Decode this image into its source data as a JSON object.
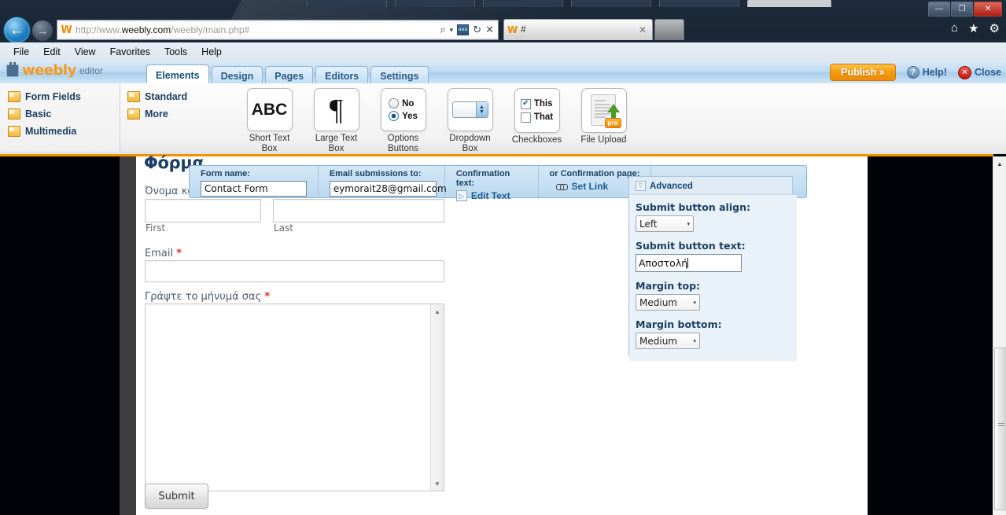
{
  "browser": {
    "url_prefix": "http://www.",
    "url_domain": "weebly.com",
    "url_suffix": "/weebly/main.php#",
    "tab_title": "#",
    "tab_favicon": "W",
    "address_favicon": "W",
    "menus": [
      "File",
      "Edit",
      "View",
      "Favorites",
      "Tools",
      "Help"
    ],
    "icons": {
      "back": "←",
      "forward": "→",
      "search": "⌕",
      "dropdown": "▾",
      "refresh": "↻",
      "stop": "✕",
      "tab_close": "✕",
      "home": "⌂",
      "favorites": "★",
      "tools": "⚙",
      "minimize": "—",
      "restore": "❐",
      "close": "✕"
    }
  },
  "editor": {
    "logo_name": "weebly",
    "logo_sub": "editor",
    "tabs": [
      {
        "label": "Elements",
        "active": true
      },
      {
        "label": "Design",
        "active": false
      },
      {
        "label": "Pages",
        "active": false
      },
      {
        "label": "Editors",
        "active": false
      },
      {
        "label": "Settings",
        "active": false
      }
    ],
    "publish_label": "Publish »",
    "help_label": "Help!",
    "help_icon": "?",
    "close_label": "Close",
    "close_icon": "✕",
    "categories": [
      "Form Fields",
      "Basic",
      "Multimedia"
    ],
    "subcategories": [
      "Standard",
      "More"
    ],
    "tools": [
      {
        "name": "Short Text Box",
        "line1": "Short Text",
        "line2": "Box",
        "glyph": "ABC"
      },
      {
        "name": "Large Text Box",
        "line1": "Large Text",
        "line2": "Box",
        "glyph": "¶"
      },
      {
        "name": "Options Buttons",
        "line1": "Options",
        "line2": "Buttons",
        "opt_no": "No",
        "opt_yes": "Yes"
      },
      {
        "name": "Dropdown Box",
        "line1": "Dropdown",
        "line2": "Box"
      },
      {
        "name": "Checkboxes",
        "line1": "Checkboxes",
        "line2": "",
        "chk_this": "This",
        "chk_that": "That",
        "check_glyph": "✔"
      },
      {
        "name": "File Upload",
        "line1": "File Upload",
        "line2": "",
        "pro_badge": "pro"
      }
    ]
  },
  "form_toolbar": {
    "form_name_label": "Form name:",
    "form_name_value": "Contact Form",
    "email_label": "Email submissions to:",
    "email_value": "eymorait28@gmail.com",
    "confirmation_text_label": "Confirmation text:",
    "edit_text_link": "Edit Text",
    "confirmation_page_label": "or Confirmation page:",
    "set_link": "Set Link"
  },
  "advanced": {
    "title": "Advanced",
    "collapse_glyph": "▽",
    "align_label": "Submit button align:",
    "align_value": "Left",
    "button_text_label": "Submit button text:",
    "button_text_value": "Αποστολή",
    "margin_top_label": "Margin top:",
    "margin_top_value": "Medium",
    "margin_bottom_label": "Margin bottom:",
    "margin_bottom_value": "Medium",
    "caret_glyph": "▾"
  },
  "page": {
    "site_title": "Φόρμα",
    "name_label": "Όνομα και",
    "first_sub": "First",
    "last_sub": "Last",
    "email_label": "Email",
    "email_required": "*",
    "message_label": "Γράψτε το μήνυμά σας",
    "message_required": "*",
    "submit_label": "Submit",
    "scroll_up_glyph": "▲",
    "scroll_down_glyph": "▼"
  },
  "colors": {
    "accent_orange": "#f39200",
    "weebly_blue": "#1b3f63",
    "required_red": "#e02b20"
  }
}
